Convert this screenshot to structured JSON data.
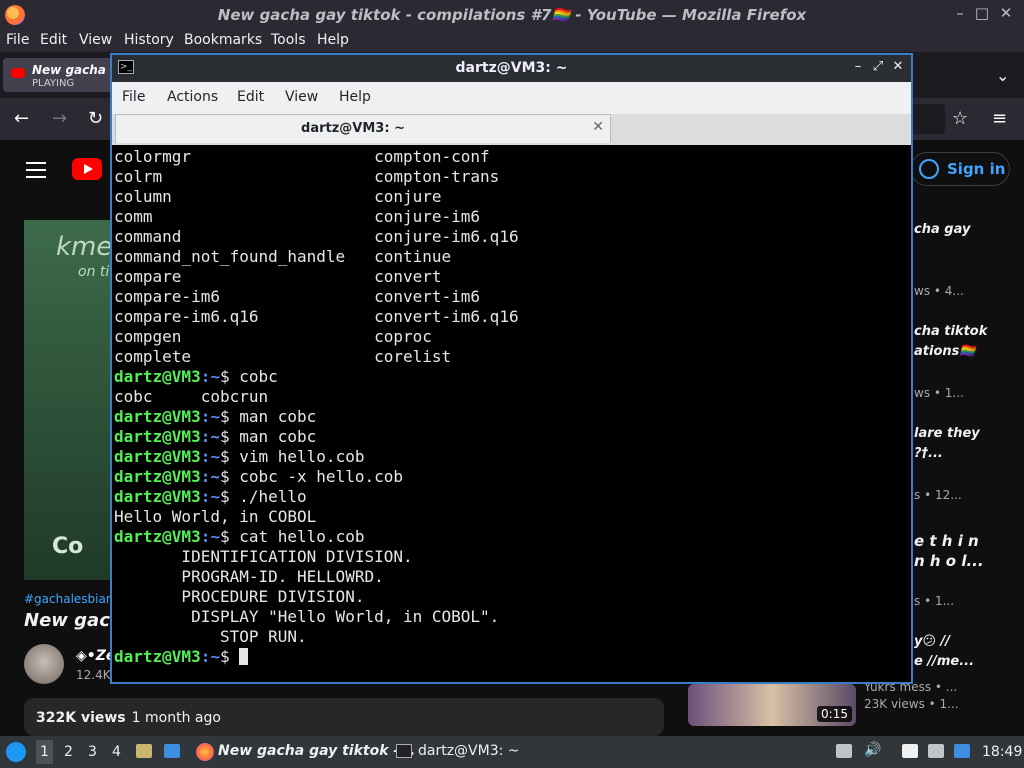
{
  "firefox": {
    "window_title": "New gacha gay tiktok - compilations #7🏳️‍🌈 - YouTube — Mozilla Firefox",
    "menu": [
      "File",
      "Edit",
      "View",
      "History",
      "Bookmarks",
      "Tools",
      "Help"
    ],
    "tab": {
      "title": "New gacha g",
      "status": "PLAYING"
    },
    "controls": {
      "minimize": "–",
      "maximize": "□",
      "close": "✕"
    }
  },
  "youtube": {
    "sign_in": "Sign in",
    "hashtag": "#gachalesbian #",
    "video_title": "New gach",
    "channel": "◈•Ze",
    "subscribers": "12.4K",
    "views": "322K views",
    "age": "1 month ago",
    "player_watermark": "kme",
    "player_watermark2": "on ti",
    "player_brand": "Co",
    "recommendations": [
      {
        "line1": "cha gay",
        "line2": "",
        "meta": "ws • 4..."
      },
      {
        "line1": "cha tiktok",
        "line2": "ations🏳️‍🌈",
        "meta": "ws • 1..."
      },
      {
        "line1": "lare they",
        "line2": "?†...",
        "meta": "s • 12..."
      },
      {
        "line1": "e t h i n",
        "line2": "n h o l...",
        "meta": "s • 1..."
      },
      {
        "line1": "y😕 //",
        "line2": "e //me...",
        "meta": ""
      }
    ],
    "last_rec": {
      "channel": "Yukrs mess • ...",
      "meta": "23K views • 1...",
      "duration": "0:15"
    }
  },
  "terminal": {
    "title": "dartz@VM3: ~",
    "menu": [
      "File",
      "Actions",
      "Edit",
      "View",
      "Help"
    ],
    "tab_title": "dartz@VM3: ~",
    "prompt_user": "dartz@VM3",
    "prompt_path": ":~",
    "lines": [
      {
        "type": "out",
        "text": "colormgr                   compton-conf"
      },
      {
        "type": "out",
        "text": "colrm                      compton-trans"
      },
      {
        "type": "out",
        "text": "column                     conjure"
      },
      {
        "type": "out",
        "text": "comm                       conjure-im6"
      },
      {
        "type": "out",
        "text": "command                    conjure-im6.q16"
      },
      {
        "type": "out",
        "text": "command_not_found_handle   continue"
      },
      {
        "type": "out",
        "text": "compare                    convert"
      },
      {
        "type": "out",
        "text": "compare-im6                convert-im6"
      },
      {
        "type": "out",
        "text": "compare-im6.q16            convert-im6.q16"
      },
      {
        "type": "out",
        "text": "compgen                    coproc"
      },
      {
        "type": "out",
        "text": "complete                   corelist"
      },
      {
        "type": "cmd",
        "text": "$ cobc"
      },
      {
        "type": "out",
        "text": "cobc     cobcrun"
      },
      {
        "type": "cmd",
        "text": "$ man cobc"
      },
      {
        "type": "cmd",
        "text": "$ man cobc"
      },
      {
        "type": "cmd",
        "text": "$ vim hello.cob"
      },
      {
        "type": "cmd",
        "text": "$ cobc -x hello.cob"
      },
      {
        "type": "cmd",
        "text": "$ ./hello"
      },
      {
        "type": "out",
        "text": "Hello World, in COBOL"
      },
      {
        "type": "cmd",
        "text": "$ cat hello.cob"
      },
      {
        "type": "out",
        "text": "       IDENTIFICATION DIVISION."
      },
      {
        "type": "out",
        "text": "       PROGRAM-ID. HELLOWRD."
      },
      {
        "type": "out",
        "text": "       PROCEDURE DIVISION."
      },
      {
        "type": "out",
        "text": "        DISPLAY \"Hello World, in COBOL\"."
      },
      {
        "type": "out",
        "text": "           STOP RUN."
      },
      {
        "type": "prompt",
        "text": "$ "
      }
    ]
  },
  "taskbar": {
    "workspaces": [
      "1",
      "2",
      "3",
      "4"
    ],
    "active_workspace": "1",
    "firefox_task": "New gacha gay tiktok -...",
    "terminal_task": "dartz@VM3: ~",
    "clock": "18:49"
  }
}
